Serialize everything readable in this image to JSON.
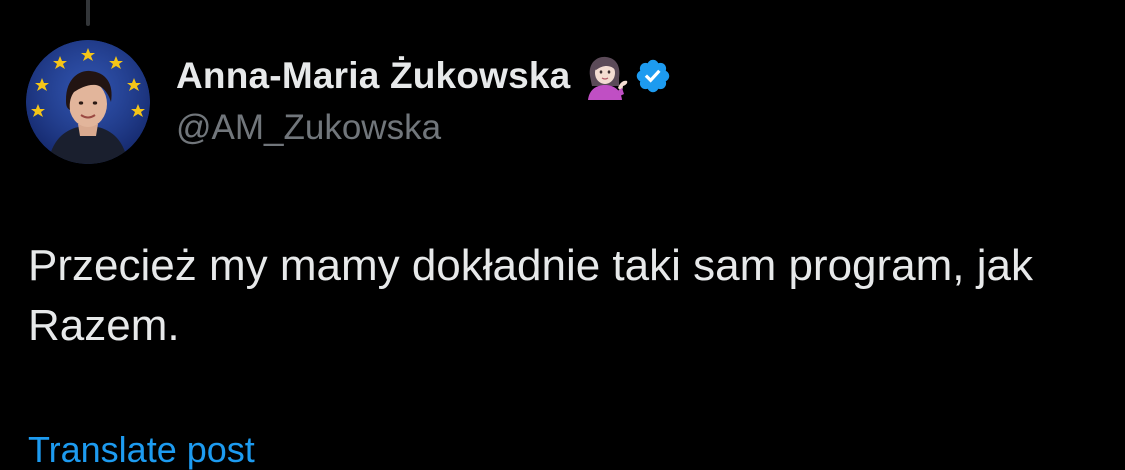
{
  "tweet": {
    "author": {
      "display_name": "Anna-Maria Żukowska",
      "handle": "@AM_Zukowska",
      "name_emoji": "woman-tipping-hand-icon",
      "verified": true,
      "verified_color": "#1d9bf0",
      "avatar_icon": "profile-photo-eu-flag-background"
    },
    "text": "Przecież my mamy dokładnie taki sam program, jak Razem.",
    "translate_label": "Translate post"
  },
  "colors": {
    "background": "#000000",
    "text_primary": "#e7e9ea",
    "text_secondary": "#71767b",
    "link": "#1d9bf0"
  }
}
